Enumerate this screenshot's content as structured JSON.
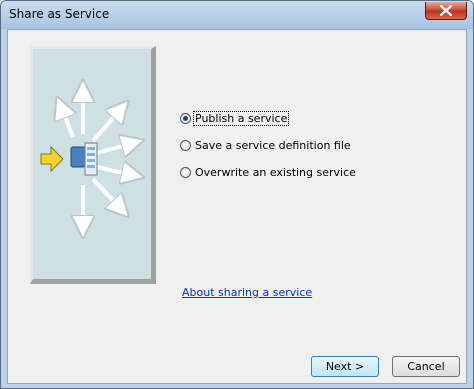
{
  "window": {
    "title": "Share as Service"
  },
  "options": [
    {
      "label": "Publish a service",
      "selected": true
    },
    {
      "label": "Save a service definition file",
      "selected": false
    },
    {
      "label": "Overwrite an existing service",
      "selected": false
    }
  ],
  "link": {
    "label": "About sharing a service"
  },
  "buttons": {
    "next": "Next >",
    "cancel": "Cancel"
  },
  "icons": {
    "close": "close-icon",
    "illustration": "share-service-illustration"
  },
  "colors": {
    "link": "#0033cc",
    "illustration_bg": "#cfe0e5",
    "arrow_yellow": "#f2d42a",
    "close_red": "#c7452f"
  }
}
